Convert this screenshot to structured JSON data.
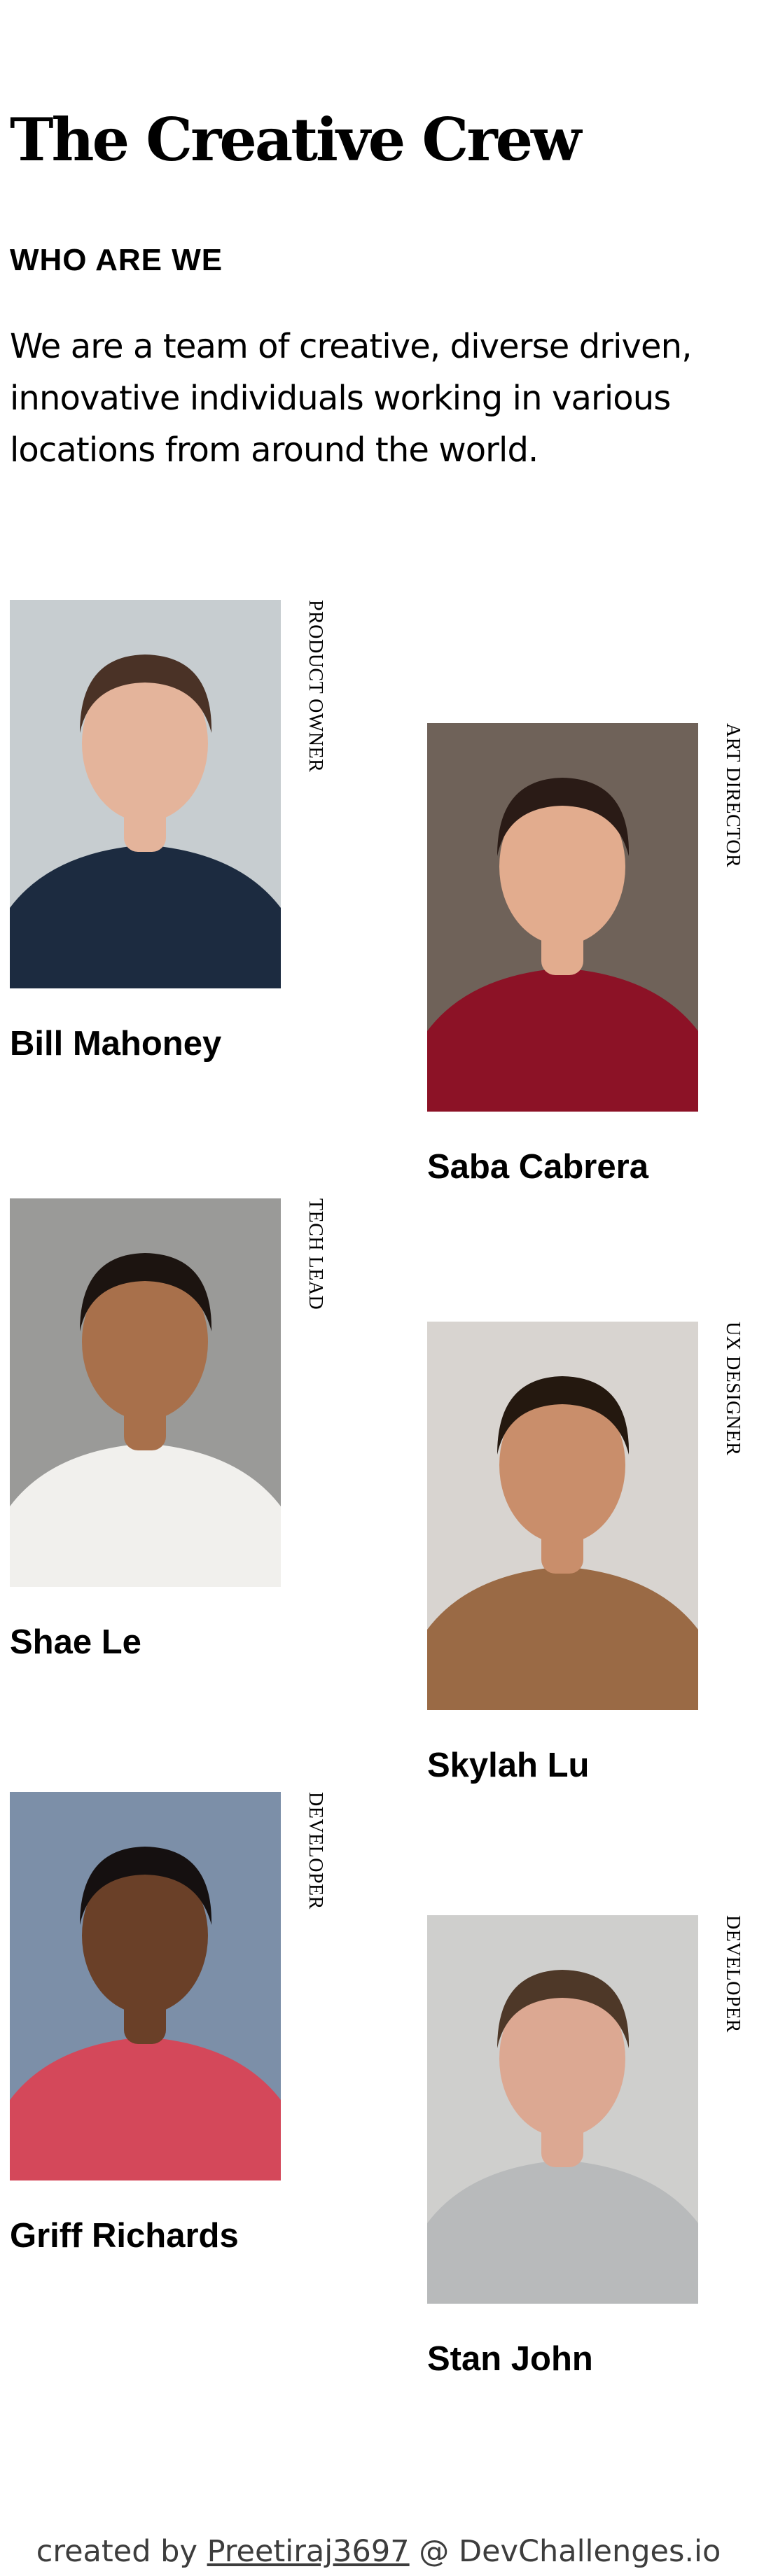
{
  "header": {
    "title": "The Creative Crew",
    "subtitle": "WHO ARE WE",
    "intro": "We are a team of creative, diverse driven, innovative individuals working in various locations from around the world."
  },
  "members": [
    {
      "name": "Bill Mahoney",
      "role": "PRODUCT OWNER",
      "photo": {
        "bg": "#c7cdd0",
        "skin": "#e4b49b",
        "hair": "#4a3226",
        "shirt": "#1c2b40"
      }
    },
    {
      "name": "Saba Cabrera",
      "role": "ART DIRECTOR",
      "photo": {
        "bg": "#6f6259",
        "skin": "#e2ac8e",
        "hair": "#2a1b16",
        "shirt": "#8c1226"
      }
    },
    {
      "name": "Shae Le",
      "role": "TECH LEAD",
      "photo": {
        "bg": "#9a9a98",
        "skin": "#a8704b",
        "hair": "#1c1410",
        "shirt": "#f1f0ed"
      }
    },
    {
      "name": "Skylah Lu",
      "role": "UX DESIGNER",
      "photo": {
        "bg": "#d8d4d0",
        "skin": "#c98e6b",
        "hair": "#24180f",
        "shirt": "#9a6a45"
      }
    },
    {
      "name": "Griff Richards",
      "role": "DEVELOPER",
      "photo": {
        "bg": "#7c8fa8",
        "skin": "#6a4028",
        "hair": "#151010",
        "shirt": "#d4485a"
      }
    },
    {
      "name": "Stan John",
      "role": "DEVELOPER",
      "photo": {
        "bg": "#cfcfcd",
        "skin": "#dca892",
        "hair": "#4e3828",
        "shirt": "#b8babb"
      }
    }
  ],
  "footer": {
    "prefix": "created by ",
    "author": "Preetiraj3697",
    "suffix": " @ DevChallenges.io"
  }
}
